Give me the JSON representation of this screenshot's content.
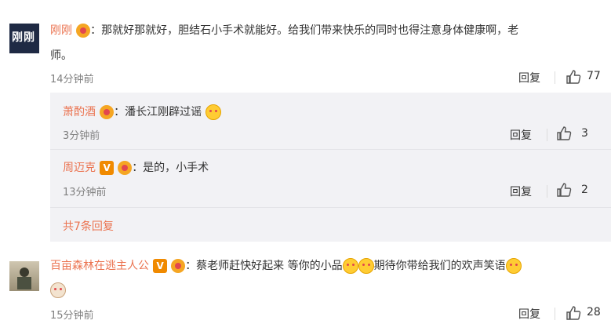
{
  "comments": [
    {
      "avatar_text": "刚刚",
      "user": "刚刚",
      "text_line1": "：那就好那就好，胆结石小手术就能好。给我们带来快乐的同时也得注意身体健康啊，老",
      "text_line2": "师。",
      "time": "14分钟前",
      "reply_label": "回复",
      "likes": "77"
    },
    {
      "user": "百亩森林在逃主人公",
      "text_part1": "：蔡老师赶快好起来 等你的小品",
      "text_part2": "期待你带给我们的欢声笑语",
      "time": "15分钟前",
      "reply_label": "回复",
      "likes": "28"
    }
  ],
  "replies": [
    {
      "user": "萧酌酒",
      "text": "：潘长江刚辟过谣",
      "time": "3分钟前",
      "reply_label": "回复",
      "likes": "3"
    },
    {
      "user": "周迈克",
      "text": "：是的，小手术",
      "time": "13分钟前",
      "reply_label": "回复",
      "likes": "2"
    }
  ],
  "more_replies": "共7条回复",
  "vip_badge": "V"
}
